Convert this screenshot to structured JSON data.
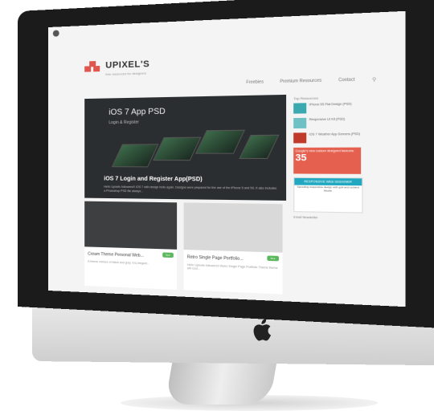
{
  "site": {
    "logo": "UPIXEL'S",
    "logo_tagline": "free resources for designers",
    "nav": [
      "Freebies",
      "Premium Resources",
      "Contact"
    ],
    "search_icon": "search-icon"
  },
  "hero": {
    "title": "iOS 7 App  PSD",
    "subtitle": "Login & Register",
    "caption": "iOS 7 Login and Register App(PSD)",
    "description": "Hello Upixels followers!!! iOS 7 with design hello again. Designs were prepared for the use of the iPhone 5 and 5S. It also includes a Photoshop PSD file always..."
  },
  "sidebar": {
    "heading": "Top Resources",
    "items": [
      "iPhone 5S Flat Design (PSD)",
      "Responsive UI Kit (PSD)",
      "iOS 7 Weather App Screens (PSD)"
    ],
    "promo_text": "Google's new custom designed favicons",
    "promo_number": "35",
    "ad_header": "RESPONSIVE WEB DESIGNER",
    "ad_text": "Speeding responsive design with grid and content blocks",
    "newsletter": "Email Newsletter"
  },
  "cards": [
    {
      "title": "Cream Theme Personal Web...",
      "tag": "free",
      "desc": "A theme mixture of black and grey. It is elegant..."
    },
    {
      "title": "Retro Single Page Portfolio...",
      "tag": "free",
      "desc": "Hello Upixels followers!! Retro Single Page Portfolio Theme theme will cool..."
    }
  ]
}
